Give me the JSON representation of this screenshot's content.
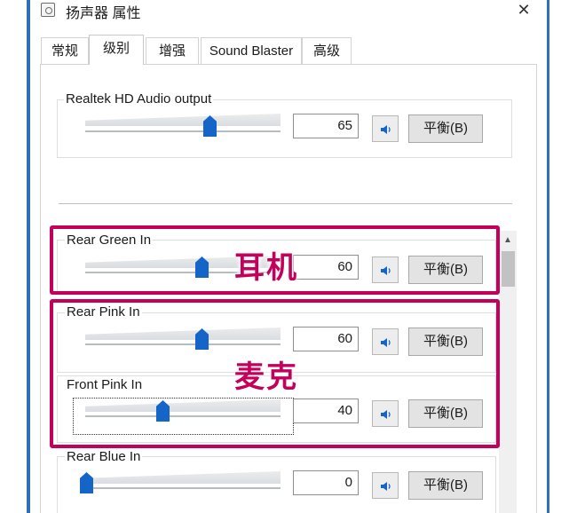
{
  "window": {
    "title": "扬声器 属性",
    "close_icon": "close-icon"
  },
  "tabs": [
    {
      "label": "常规"
    },
    {
      "label": "级别"
    },
    {
      "label": "增强"
    },
    {
      "label": "Sound Blaster"
    },
    {
      "label": "高级"
    }
  ],
  "active_tab": "级别",
  "master": {
    "name": "Realtek HD Audio output",
    "value": "65",
    "level_percent": 65,
    "balance_label": "平衡(B)"
  },
  "channels": [
    {
      "name": "Rear Green In",
      "value": "60",
      "level_percent": 60,
      "balance_label": "平衡(B)"
    },
    {
      "name": "Rear Pink In",
      "value": "60",
      "level_percent": 60,
      "balance_label": "平衡(B)"
    },
    {
      "name": "Front Pink In",
      "value": "40",
      "level_percent": 40,
      "balance_label": "平衡(B)"
    },
    {
      "name": "Rear Blue In",
      "value": "0",
      "level_percent": 0,
      "balance_label": "平衡(B)"
    }
  ],
  "annotations": {
    "headphone": "耳机",
    "microphone": "麦克"
  },
  "colors": {
    "accent": "#1565c9",
    "highlight": "#c4005b",
    "window_border": "#2e6fb8"
  }
}
